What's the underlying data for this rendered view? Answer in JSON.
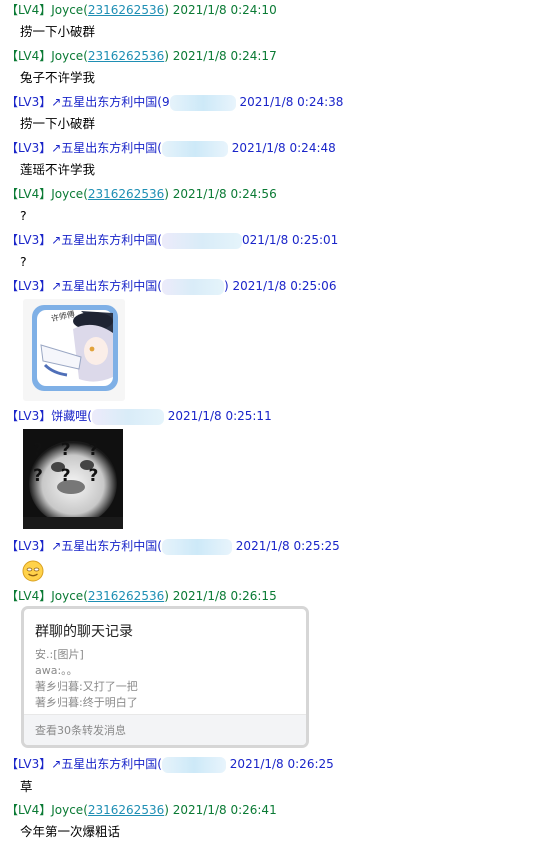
{
  "messages": [
    {
      "level": "【LV4】",
      "sender": "Joyce",
      "qq": "2316262536",
      "time": "2021/1/8 0:24:10",
      "text": "捞一下小破群"
    },
    {
      "level": "【LV4】",
      "sender": "Joyce",
      "qq": "2316262536",
      "time": "2021/1/8 0:24:17",
      "text": "兔子不许学我"
    },
    {
      "level": "【LV3】",
      "sender": "↗五星出东方利中国(",
      "qq_hidden_prefix": "9",
      "time": "2021/1/8 0:24:38",
      "text": "捞一下小破群"
    },
    {
      "level": "【LV3】",
      "sender": "↗五星出东方利中国(",
      "time": "2021/1/8 0:24:48",
      "text": "莲瑶不许学我"
    },
    {
      "level": "【LV4】",
      "sender": "Joyce",
      "qq": "2316262536",
      "time": "2021/1/8 0:24:56",
      "text": "?"
    },
    {
      "level": "【LV3】",
      "sender": "↗五星出东方利中国(",
      "time": "021/1/8 0:25:01",
      "text": "?"
    },
    {
      "level": "【LV3】",
      "sender": "↗五星出东方利中国(",
      "time_suffix": ")",
      "time": "2021/1/8 0:25:06",
      "sticker_caption": "许师傅"
    },
    {
      "level": "【LV3】",
      "sender": "饼藏哩(",
      "time": "2021/1/8 0:25:11",
      "sticker_marks": "? ? ? ? ? ?"
    },
    {
      "level": "【LV3】",
      "sender": "↗五星出东方利中国(",
      "time": "2021/1/8 0:25:25",
      "emoji": "smile-emoji"
    },
    {
      "level": "【LV4】",
      "sender": "Joyce",
      "qq": "2316262536",
      "time": "2021/1/8 0:26:15"
    },
    {
      "level": "【LV3】",
      "sender": "↗五星出东方利中国(",
      "time": "2021/1/8 0:26:25",
      "text": "草"
    },
    {
      "level": "【LV4】",
      "sender": "Joyce",
      "qq": "2316262536",
      "time": "2021/1/8 0:26:41",
      "text": "今年第一次爆粗话"
    }
  ],
  "forward_card": {
    "title": "群聊的聊天记录",
    "lines": [
      "安.:[图片]",
      "awa:。。",
      "著乡归暮:又打了一把",
      "著乡归暮:终于明白了"
    ],
    "footer": "查看30条转发消息"
  },
  "colors": {
    "lv4": "#0a7a34",
    "lv3": "#1a25c9",
    "qq_link": "#1f8fb4"
  }
}
